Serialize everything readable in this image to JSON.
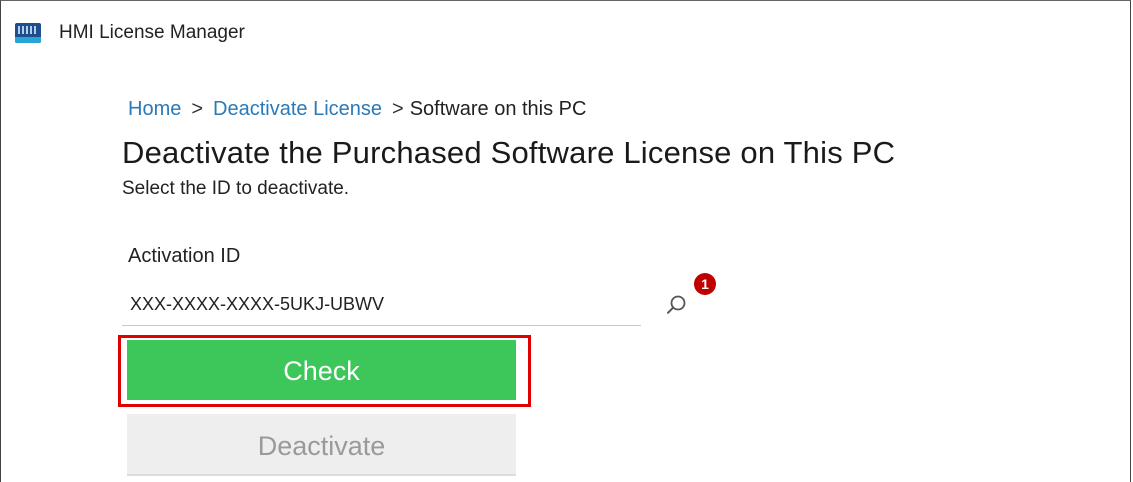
{
  "window": {
    "title": "HMI License Manager",
    "icon": "hmi-app-icon"
  },
  "breadcrumb": {
    "items": [
      {
        "label": "Home",
        "link": true
      },
      {
        "label": "Deactivate License",
        "link": true
      },
      {
        "label": "Software on this PC",
        "link": false
      }
    ],
    "separator": ">"
  },
  "page": {
    "title": "Deactivate the Purchased Software License on This PC",
    "subtitle": "Select the ID to deactivate."
  },
  "activation": {
    "label": "Activation ID",
    "value": "XXX-XXXX-XXXX-5UKJ-UBWV",
    "search_icon": "search-icon",
    "badge": "1"
  },
  "buttons": {
    "check": "Check",
    "deactivate": "Deactivate"
  },
  "colors": {
    "link": "#2a7ab8",
    "check_button": "#3dc65a",
    "highlight": "#e00000",
    "badge": "#c00000",
    "disabled_button": "#eeeeee"
  }
}
